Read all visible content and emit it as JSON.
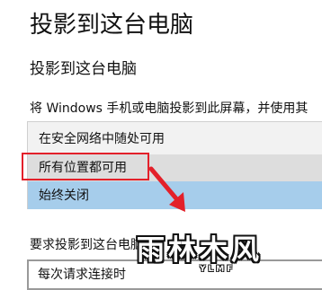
{
  "page": {
    "title": "投影到这台电脑"
  },
  "section": {
    "title": "投影到这台电脑",
    "description": "将 Windows 手机或电脑投影到此屏幕，并使用其"
  },
  "availability_dropdown": {
    "options": [
      {
        "label": "在安全网络中随处可用"
      },
      {
        "label": "所有位置都可用"
      },
      {
        "label": "始终关闭"
      }
    ],
    "highlighted_index": 1,
    "selected_index": 2
  },
  "ask_section": {
    "label": "要求投影到这台电脑",
    "select_value": "每次请求连接时"
  },
  "watermark": {
    "text": "雨林木风",
    "sub": "YLMF"
  },
  "colors": {
    "highlight_box": "#e3202a",
    "arrow": "#e3202a",
    "selected_option": "#a6cdeb",
    "hover_option": "#dddddd"
  }
}
